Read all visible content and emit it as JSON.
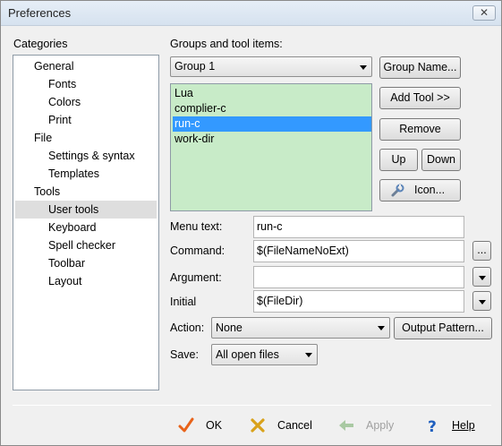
{
  "window": {
    "title": "Preferences",
    "close_glyph": "✕"
  },
  "categories": {
    "label": "Categories",
    "items": [
      {
        "label": "General",
        "indent": 1
      },
      {
        "label": "Fonts",
        "indent": 2
      },
      {
        "label": "Colors",
        "indent": 2
      },
      {
        "label": "Print",
        "indent": 2
      },
      {
        "label": "File",
        "indent": 1
      },
      {
        "label": "Settings & syntax",
        "indent": 2
      },
      {
        "label": "Templates",
        "indent": 2
      },
      {
        "label": "Tools",
        "indent": 1
      },
      {
        "label": "User tools",
        "indent": 2,
        "selected": true
      },
      {
        "label": "Keyboard",
        "indent": 2
      },
      {
        "label": "Spell checker",
        "indent": 2
      },
      {
        "label": "Toolbar",
        "indent": 2
      },
      {
        "label": "Layout",
        "indent": 2
      }
    ]
  },
  "groups": {
    "label": "Groups and tool items:",
    "selected_group": "Group 1",
    "tools": [
      "Lua",
      "complier-c",
      "run-c",
      "work-dir"
    ],
    "selected_tool": "run-c",
    "list_color": "#c8ebc8"
  },
  "buttons": {
    "group_name": "Group Name...",
    "add_tool": "Add Tool >>",
    "remove": "Remove",
    "up": "Up",
    "down": "Down",
    "icon": "Icon...",
    "browse": "...",
    "output_pattern": "Output Pattern..."
  },
  "form": {
    "menu_text_label": "Menu text:",
    "menu_text_value": "run-c",
    "command_label": "Command:",
    "command_value": "$(FileNameNoExt)",
    "argument_label": "Argument:",
    "argument_value": "",
    "initial_label": "Initial",
    "initial_value": "$(FileDir)",
    "action_label": "Action:",
    "action_value": "None",
    "save_label": "Save:",
    "save_value": "All open files"
  },
  "footer": {
    "ok": "OK",
    "cancel": "Cancel",
    "apply": "Apply",
    "help": "Help",
    "colors": {
      "ok": "#e8631a",
      "cancel": "#d9a21b",
      "apply_disabled": "#a9c9a3",
      "help": "#1f5fbf",
      "selection": "#3399ff"
    }
  }
}
